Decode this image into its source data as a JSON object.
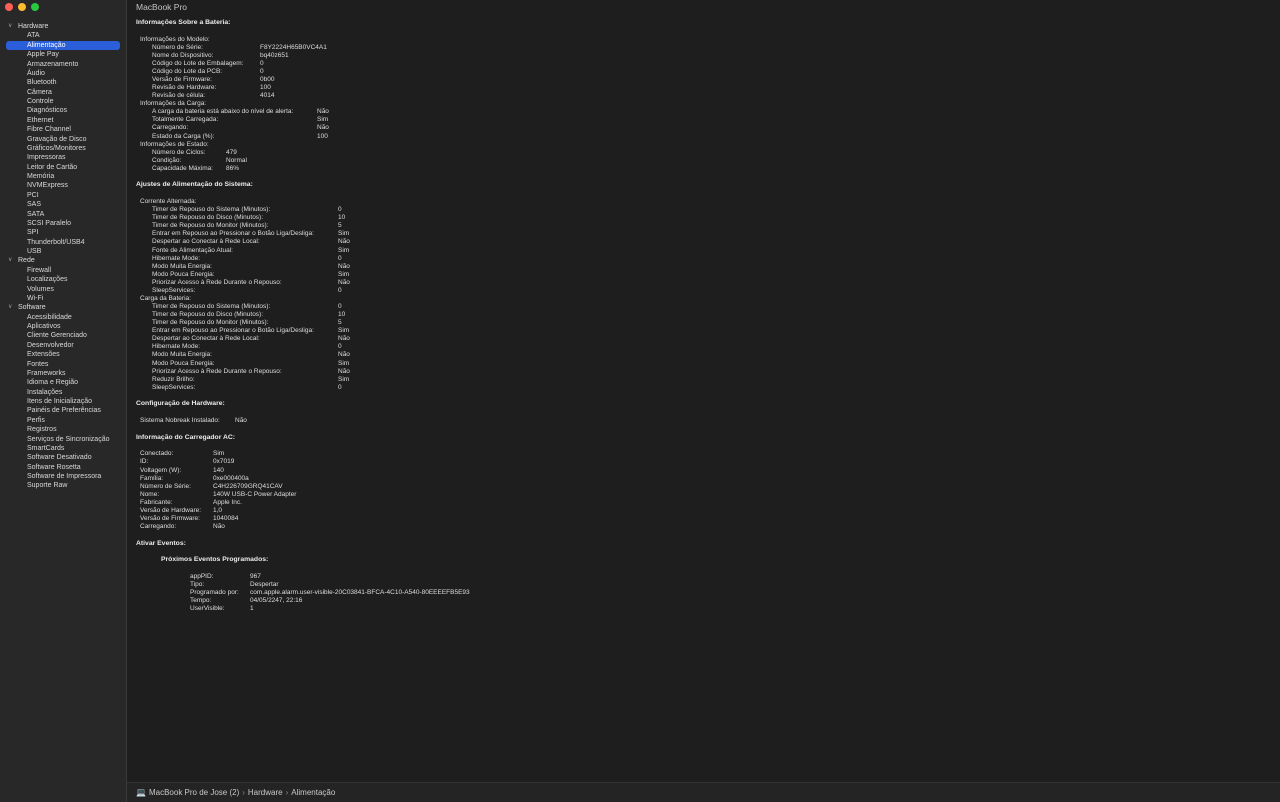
{
  "window": {
    "title": "MacBook Pro"
  },
  "sidebar": {
    "groups": [
      {
        "label": "Hardware",
        "items": [
          "ATA",
          "Alimentação",
          "Apple Pay",
          "Armazenamento",
          "Áudio",
          "Bluetooth",
          "Câmera",
          "Controle",
          "Diagnósticos",
          "Ethernet",
          "Fibre Channel",
          "Gravação de Disco",
          "Gráficos/Monitores",
          "Impressoras",
          "Leitor de Cartão",
          "Memória",
          "NVMExpress",
          "PCI",
          "SAS",
          "SATA",
          "SCSI Paralelo",
          "SPI",
          "Thunderbolt/USB4",
          "USB"
        ]
      },
      {
        "label": "Rede",
        "items": [
          "Firewall",
          "Localizações",
          "Volumes",
          "Wi-Fi"
        ]
      },
      {
        "label": "Software",
        "items": [
          "Acessibilidade",
          "Aplicativos",
          "Cliente Gerenciado",
          "Desenvolvedor",
          "Extensões",
          "Fontes",
          "Frameworks",
          "Idioma e Região",
          "Instalações",
          "Itens de Inicialização",
          "Painéis de Preferências",
          "Perfis",
          "Registros",
          "Serviços de Sincronização",
          "SmartCards",
          "Software Desativado",
          "Software Rosetta",
          "Software de Impressora",
          "Suporte Raw"
        ]
      }
    ],
    "selected": "Alimentação"
  },
  "content": {
    "lines": [
      {
        "t": "h",
        "text": "Informações Sobre a Bateria:"
      },
      {
        "t": "s"
      },
      {
        "t": "kv",
        "indent": 1,
        "label": "Informações do Modelo:",
        "value": ""
      },
      {
        "t": "kv",
        "indent": 2,
        "label": "Número de Série:",
        "value": "F8Y2224H65B0VC4A1",
        "vx": 260
      },
      {
        "t": "kv",
        "indent": 2,
        "label": "Nome do Dispositivo:",
        "value": "bq40z651",
        "vx": 260
      },
      {
        "t": "kv",
        "indent": 2,
        "label": "Código do Lote de Embalagem:",
        "value": "0",
        "vx": 260
      },
      {
        "t": "kv",
        "indent": 2,
        "label": "Código do Lote da PCB:",
        "value": "0",
        "vx": 260
      },
      {
        "t": "kv",
        "indent": 2,
        "label": "Versão de Firmware:",
        "value": "0b00",
        "vx": 260
      },
      {
        "t": "kv",
        "indent": 2,
        "label": "Revisão de Hardware:",
        "value": "100",
        "vx": 260
      },
      {
        "t": "kv",
        "indent": 2,
        "label": "Revisão de célula:",
        "value": "4014",
        "vx": 260
      },
      {
        "t": "kv",
        "indent": 1,
        "label": "Informações da Carga:",
        "value": ""
      },
      {
        "t": "kv",
        "indent": 2,
        "label": "A carga da bateria está abaixo do nível de alerta:",
        "value": "Não",
        "vx": 317
      },
      {
        "t": "kv",
        "indent": 2,
        "label": "Totalmente Carregada:",
        "value": "Sim",
        "vx": 317
      },
      {
        "t": "kv",
        "indent": 2,
        "label": "Carregando:",
        "value": "Não",
        "vx": 317
      },
      {
        "t": "kv",
        "indent": 2,
        "label": "Estado da Carga (%):",
        "value": "100",
        "vx": 317
      },
      {
        "t": "kv",
        "indent": 1,
        "label": "Informações de Estado:",
        "value": ""
      },
      {
        "t": "kv",
        "indent": 2,
        "label": "Número de Ciclos:",
        "value": "479",
        "vx": 226
      },
      {
        "t": "kv",
        "indent": 2,
        "label": "Condição:",
        "value": "Normal",
        "vx": 226
      },
      {
        "t": "kv",
        "indent": 2,
        "label": "Capacidade Máxima:",
        "value": "86%",
        "vx": 226
      },
      {
        "t": "s"
      },
      {
        "t": "h",
        "text": "Ajustes de Alimentação do Sistema:"
      },
      {
        "t": "s"
      },
      {
        "t": "kv",
        "indent": 1,
        "label": "Corrente Alternada:",
        "value": ""
      },
      {
        "t": "kv",
        "indent": 2,
        "label": "Timer de Repouso do Sistema (Minutos):",
        "value": "0",
        "vx": 338
      },
      {
        "t": "kv",
        "indent": 2,
        "label": "Timer de Repouso do Disco (Minutos):",
        "value": "10",
        "vx": 338
      },
      {
        "t": "kv",
        "indent": 2,
        "label": "Timer de Repouso do Monitor (Minutos):",
        "value": "5",
        "vx": 338
      },
      {
        "t": "kv",
        "indent": 2,
        "label": "Entrar em Repouso ao Pressionar o Botão Liga/Desliga:",
        "value": "Sim",
        "vx": 338
      },
      {
        "t": "kv",
        "indent": 2,
        "label": "Despertar ao Conectar à Rede Local:",
        "value": "Não",
        "vx": 338
      },
      {
        "t": "kv",
        "indent": 2,
        "label": "Fonte de Alimentação Atual:",
        "value": "Sim",
        "vx": 338
      },
      {
        "t": "kv",
        "indent": 2,
        "label": "Hibernate Mode:",
        "value": "0",
        "vx": 338
      },
      {
        "t": "kv",
        "indent": 2,
        "label": "Modo Muita Energia:",
        "value": "Não",
        "vx": 338
      },
      {
        "t": "kv",
        "indent": 2,
        "label": "Modo Pouca Energia:",
        "value": "Sim",
        "vx": 338
      },
      {
        "t": "kv",
        "indent": 2,
        "label": "Priorizar Acesso à Rede Durante o Repouso:",
        "value": "Não",
        "vx": 338
      },
      {
        "t": "kv",
        "indent": 2,
        "label": "SleepServices:",
        "value": "0",
        "vx": 338
      },
      {
        "t": "kv",
        "indent": 1,
        "label": "Carga da Bateria:",
        "value": ""
      },
      {
        "t": "kv",
        "indent": 2,
        "label": "Timer de Repouso do Sistema (Minutos):",
        "value": "0",
        "vx": 338
      },
      {
        "t": "kv",
        "indent": 2,
        "label": "Timer de Repouso do Disco (Minutos):",
        "value": "10",
        "vx": 338
      },
      {
        "t": "kv",
        "indent": 2,
        "label": "Timer de Repouso do Monitor (Minutos):",
        "value": "5",
        "vx": 338
      },
      {
        "t": "kv",
        "indent": 2,
        "label": "Entrar em Repouso ao Pressionar o Botão Liga/Desliga:",
        "value": "Sim",
        "vx": 338
      },
      {
        "t": "kv",
        "indent": 2,
        "label": "Despertar ao Conectar à Rede Local:",
        "value": "Não",
        "vx": 338
      },
      {
        "t": "kv",
        "indent": 2,
        "label": "Hibernate Mode:",
        "value": "0",
        "vx": 338
      },
      {
        "t": "kv",
        "indent": 2,
        "label": "Modo Muita Energia:",
        "value": "Não",
        "vx": 338
      },
      {
        "t": "kv",
        "indent": 2,
        "label": "Modo Pouca Energia:",
        "value": "Sim",
        "vx": 338
      },
      {
        "t": "kv",
        "indent": 2,
        "label": "Priorizar Acesso à Rede Durante o Repouso:",
        "value": "Não",
        "vx": 338
      },
      {
        "t": "kv",
        "indent": 2,
        "label": "Reduzir Brilho:",
        "value": "Sim",
        "vx": 338
      },
      {
        "t": "kv",
        "indent": 2,
        "label": "SleepServices:",
        "value": "0",
        "vx": 338
      },
      {
        "t": "s"
      },
      {
        "t": "h",
        "text": "Configuração de Hardware:"
      },
      {
        "t": "s"
      },
      {
        "t": "kv",
        "indent": 1,
        "label": "Sistema Nobreak Instalado:",
        "value": "Não",
        "vx": 235
      },
      {
        "t": "s"
      },
      {
        "t": "h",
        "text": "Informação do Carregador AC:"
      },
      {
        "t": "s"
      },
      {
        "t": "kv",
        "indent": 1,
        "label": "Conectado:",
        "value": "Sim",
        "vx": 213
      },
      {
        "t": "kv",
        "indent": 1,
        "label": "ID:",
        "value": "0x7019",
        "vx": 213
      },
      {
        "t": "kv",
        "indent": 1,
        "label": "Voltagem (W):",
        "value": "140",
        "vx": 213
      },
      {
        "t": "kv",
        "indent": 1,
        "label": "Família:",
        "value": "0xe000400a",
        "vx": 213
      },
      {
        "t": "kv",
        "indent": 1,
        "label": "Número de Série:",
        "value": "C4H226709GRQ41CAV",
        "vx": 213
      },
      {
        "t": "kv",
        "indent": 1,
        "label": "Nome:",
        "value": "140W USB-C Power Adapter",
        "vx": 213
      },
      {
        "t": "kv",
        "indent": 1,
        "label": "Fabricante:",
        "value": "Apple Inc.",
        "vx": 213
      },
      {
        "t": "kv",
        "indent": 1,
        "label": "Versão de Hardware:",
        "value": "1,0",
        "vx": 213
      },
      {
        "t": "kv",
        "indent": 1,
        "label": "Versão de Firmware:",
        "value": "1040084",
        "vx": 213
      },
      {
        "t": "kv",
        "indent": 1,
        "label": "Carregando:",
        "value": "Não",
        "vx": 213
      },
      {
        "t": "s"
      },
      {
        "t": "h",
        "text": "Ativar Eventos:"
      },
      {
        "t": "s"
      },
      {
        "t": "h",
        "indent": 3,
        "text": "Próximos Eventos Programados:"
      },
      {
        "t": "s"
      },
      {
        "t": "kv",
        "indent": 4,
        "label": "appPID:",
        "value": "967",
        "vx": 250
      },
      {
        "t": "kv",
        "indent": 4,
        "label": "Tipo:",
        "value": "Despertar",
        "vx": 250
      },
      {
        "t": "kv",
        "indent": 4,
        "label": "Programado por:",
        "value": "com.apple.alarm.user-visible-20C03841-BFCA-4C10-A540-80EEEEFB5E93",
        "vx": 250
      },
      {
        "t": "kv",
        "indent": 4,
        "label": "Tempo:",
        "value": "04/05/2247, 22:16",
        "vx": 250
      },
      {
        "t": "kv",
        "indent": 4,
        "label": "UserVisible:",
        "value": "1",
        "vx": 250
      }
    ]
  },
  "pathbar": {
    "items": [
      "MacBook Pro de Jose (2)",
      "Hardware",
      "Alimentação"
    ]
  }
}
